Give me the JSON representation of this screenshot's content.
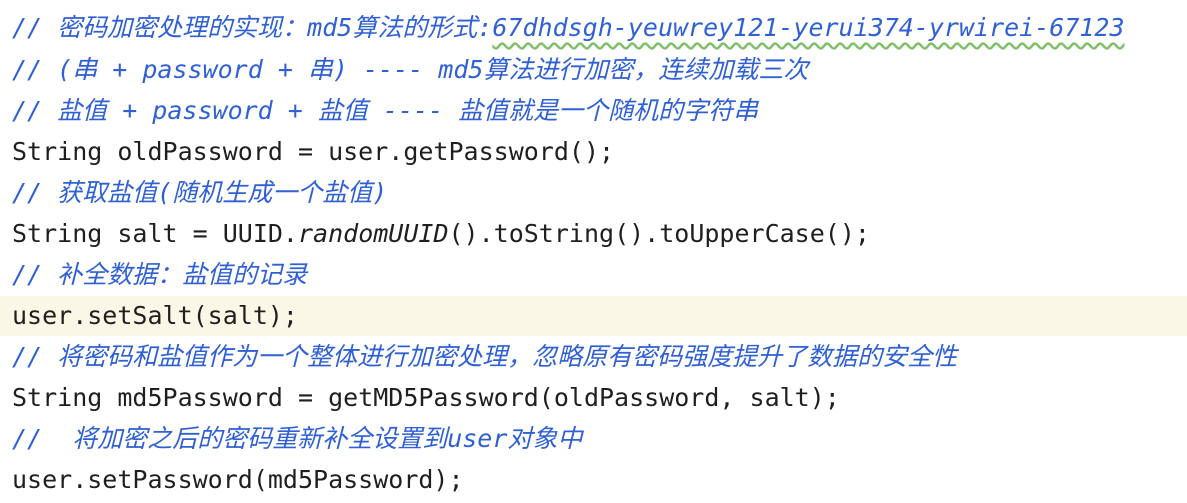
{
  "code_editor": {
    "lines": [
      {
        "kind": "comment",
        "prefix": "// 密码加密处理的实现：md5算法的形式:",
        "underlined": "67dhdsgh-yeuwrey121-yerui374-yrwirei-67123"
      },
      {
        "kind": "comment",
        "text": "// (串 + password + 串) ---- md5算法进行加密，连续加载三次"
      },
      {
        "kind": "comment",
        "text": "// 盐值 + password + 盐值 ---- 盐值就是一个随机的字符串"
      },
      {
        "kind": "code",
        "text": "String oldPassword = user.getPassword();"
      },
      {
        "kind": "comment",
        "text": "// 获取盐值(随机生成一个盐值)"
      },
      {
        "kind": "code",
        "before": "String salt = UUID.",
        "italic": "randomUUID",
        "after": "().toString().toUpperCase();"
      },
      {
        "kind": "comment",
        "text": "// 补全数据：盐值的记录"
      },
      {
        "kind": "code",
        "text": "user.setSalt(salt);",
        "current": true
      },
      {
        "kind": "comment",
        "text": "// 将密码和盐值作为一个整体进行加密处理，忽略原有密码强度提升了数据的安全性"
      },
      {
        "kind": "code",
        "text": "String md5Password = getMD5Password(oldPassword, salt);"
      },
      {
        "kind": "comment",
        "text": "//  将加密之后的密码重新补全设置到user对象中"
      },
      {
        "kind": "code",
        "text": "user.setPassword(md5Password);"
      }
    ]
  }
}
